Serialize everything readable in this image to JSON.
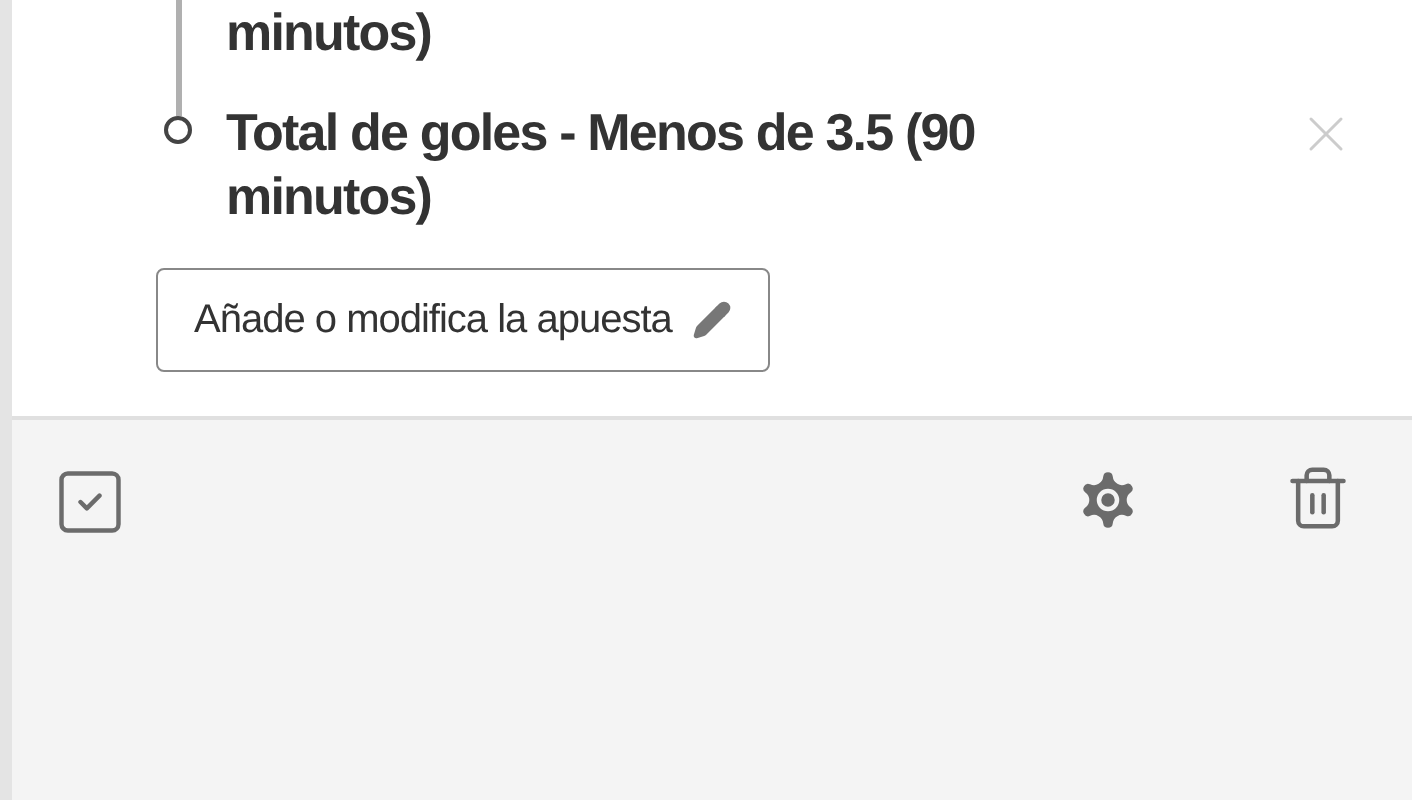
{
  "selections": [
    {
      "title": "minutos)",
      "removable": false
    },
    {
      "title": "Total de goles - Menos de 3.5 (90 minutos)",
      "removable": true
    }
  ],
  "edit_button": {
    "label": "Añade o modifica la apuesta"
  }
}
